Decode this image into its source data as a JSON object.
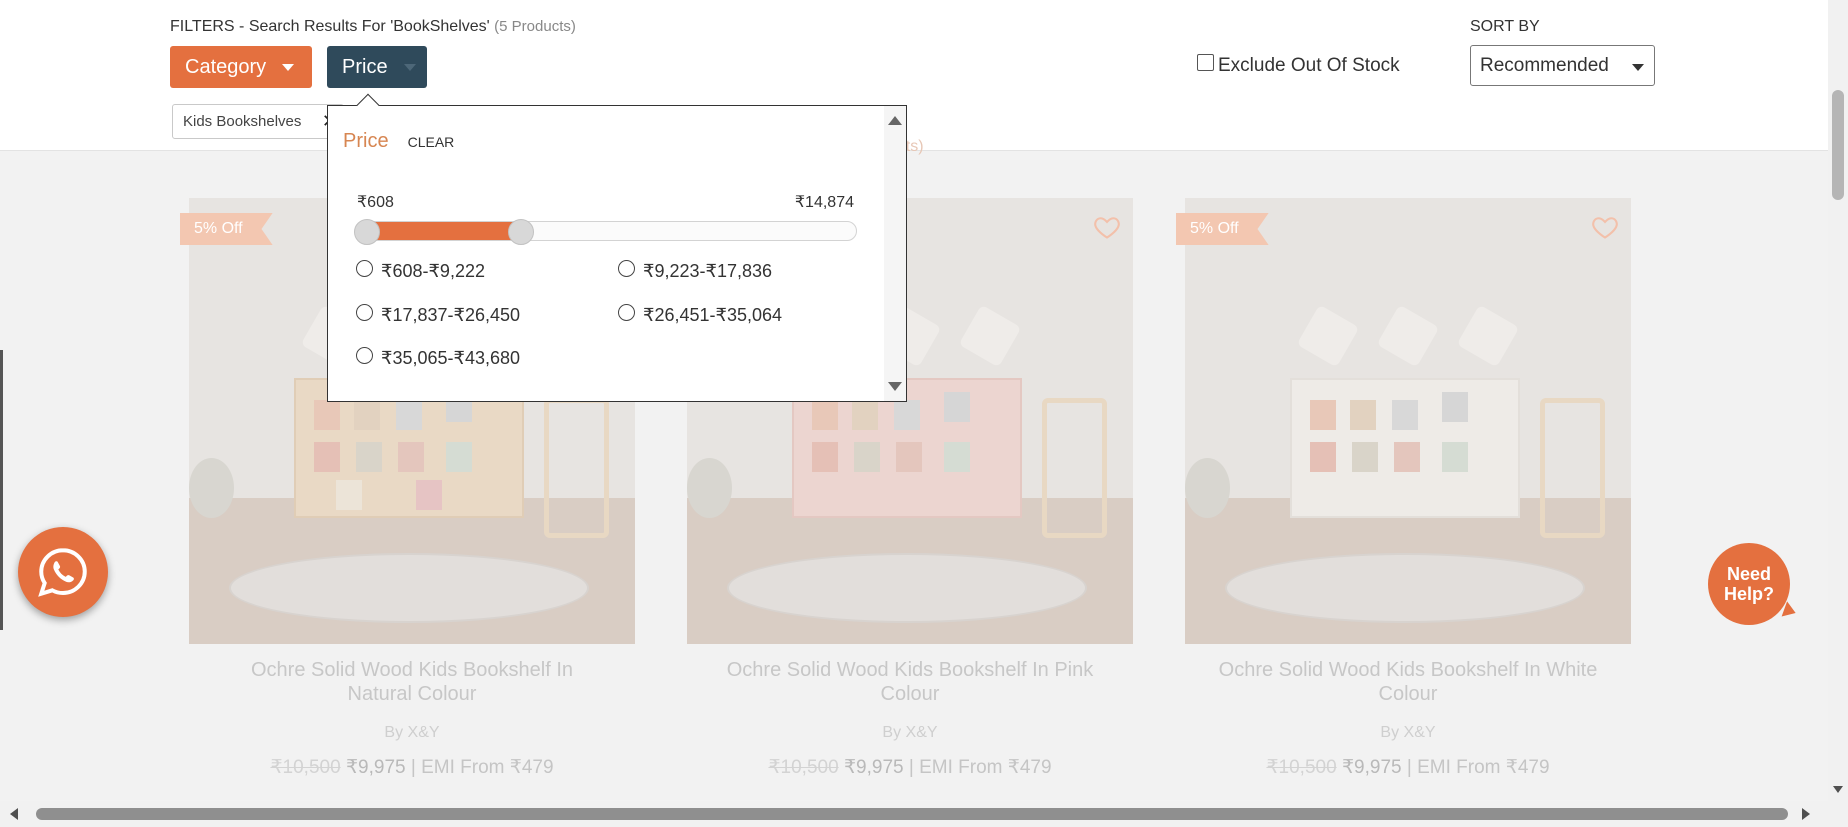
{
  "filters": {
    "title": "FILTERS - Search Results For 'BookShelves'",
    "count": "(5 Products)",
    "category_label": "Category",
    "price_label": "Price",
    "active_chip": "Kids Bookshelves",
    "chip_remove": "✕",
    "exclude_label": "Exclude Out Of Stock",
    "faded_count": "ducts)"
  },
  "sort": {
    "label": "SORT BY",
    "selected": "Recommended"
  },
  "price_dropdown": {
    "title": "Price",
    "clear": "CLEAR",
    "min": "₹608",
    "max": "₹14,874",
    "options": [
      "₹608-₹9,222",
      "₹9,223-₹17,836",
      "₹17,837-₹26,450",
      "₹26,451-₹35,064",
      "₹35,065-₹43,680"
    ],
    "slider_fill_fraction": 0.33
  },
  "products": [
    {
      "badge": "5% Off",
      "name_line1": "Ochre Solid Wood Kids Bookshelf In",
      "name_line2": "Natural Colour",
      "brand": "By X&Y",
      "mrp": "₹10,500",
      "price": "₹9,975",
      "emi": "| EMI From ₹479"
    },
    {
      "badge": "",
      "name_line1": "Ochre Solid Wood Kids Bookshelf In Pink",
      "name_line2": "Colour",
      "brand": "By X&Y",
      "mrp": "₹10,500",
      "price": "₹9,975",
      "emi": "| EMI From ₹479"
    },
    {
      "badge": "5% Off",
      "name_line1": "Ochre Solid Wood Kids Bookshelf In White",
      "name_line2": "Colour",
      "brand": "By X&Y",
      "mrp": "₹10,500",
      "price": "₹9,975",
      "emi": "| EMI From ₹479"
    }
  ],
  "help": {
    "line1": "Need",
    "line2": "Help?"
  },
  "colors": {
    "accent": "#e4703f",
    "dark": "#2f4a5b"
  },
  "icons": [
    "whatsapp-icon",
    "heart-icon",
    "close-icon",
    "chevron-down-icon"
  ]
}
